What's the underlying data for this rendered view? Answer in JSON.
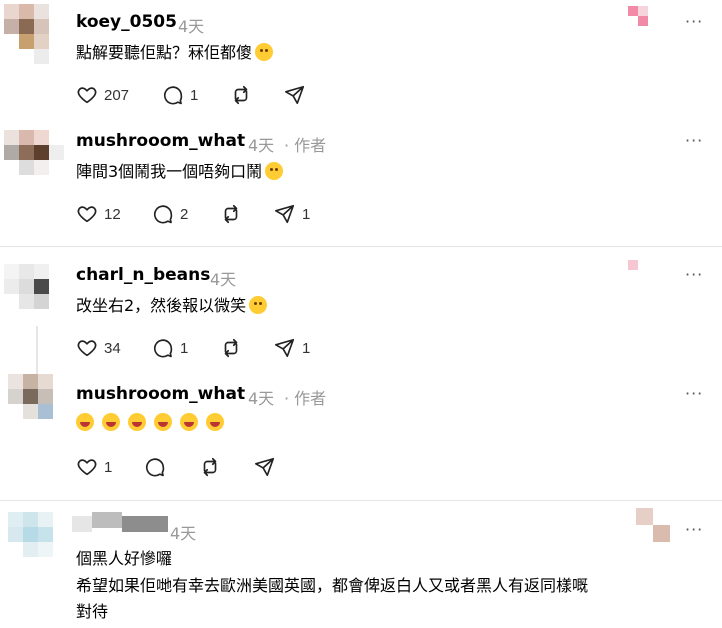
{
  "comments": [
    {
      "username": "koey_0505",
      "time": "4天",
      "author_tag": "",
      "text": "點解要聽佢點？冧佢都傻",
      "emoji": "🙄",
      "likes": "207",
      "replies": "1",
      "reposts": "",
      "shares": ""
    },
    {
      "username": "mushrooom_what",
      "time": "4天",
      "author_tag": "· 作者",
      "text": "陣間3個鬧我一個唔夠口鬧",
      "emoji": "🤪",
      "likes": "12",
      "replies": "2",
      "reposts": "",
      "shares": "1"
    },
    {
      "username": "charl_n_beans",
      "time": "4天",
      "author_tag": "",
      "text": "改坐右2，然後報以微笑",
      "emoji": "😊",
      "likes": "34",
      "replies": "1",
      "reposts": "",
      "shares": "1"
    },
    {
      "username": "mushrooom_what",
      "time": "4天",
      "author_tag": "· 作者",
      "text": "",
      "emoji": "🤣🤣🤣🤣🤣🤣",
      "likes": "1",
      "replies": "",
      "reposts": "",
      "shares": ""
    },
    {
      "username": "",
      "time": "4天",
      "author_tag": "",
      "text_lines": [
        "個黑人好慘囉",
        "希望如果佢哋有幸去歐洲美國英國，都會俾返白人又或者黑人有返同樣嘅",
        "對待"
      ]
    }
  ],
  "icons": {
    "like": "heart-icon",
    "reply": "speech-bubble-icon",
    "repost": "repost-icon",
    "share": "send-icon",
    "more": "more-icon"
  },
  "more_label": "···"
}
